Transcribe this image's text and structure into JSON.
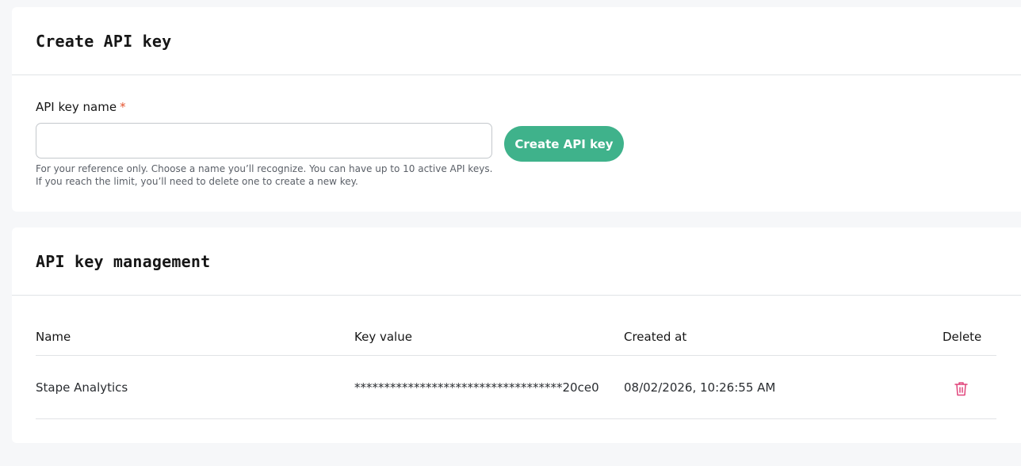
{
  "create_section": {
    "title": "Create API key",
    "field_label": "API key name",
    "required_mark": "*",
    "input_value": "",
    "input_placeholder": "",
    "helper_text": "For your reference only. Choose a name you’ll recognize. You can have up to 10 active API keys. If you reach the limit, you’ll need to delete one to create a new key.",
    "button_label": "Create API key"
  },
  "management_section": {
    "title": "API key management",
    "columns": {
      "name": "Name",
      "key_value": "Key value",
      "created_at": "Created at",
      "delete": "Delete"
    },
    "rows": [
      {
        "name": "Stape Analytics",
        "key_value": "***********************************20ce0",
        "created_at": "08/02/2026, 10:26:55 AM",
        "delete_icon": "trash-icon"
      }
    ]
  },
  "colors": {
    "accent_green": "#3fb28b",
    "required_red": "#e5542f",
    "delete_icon_color": "#e0457b",
    "page_background": "#f6f7f9"
  }
}
